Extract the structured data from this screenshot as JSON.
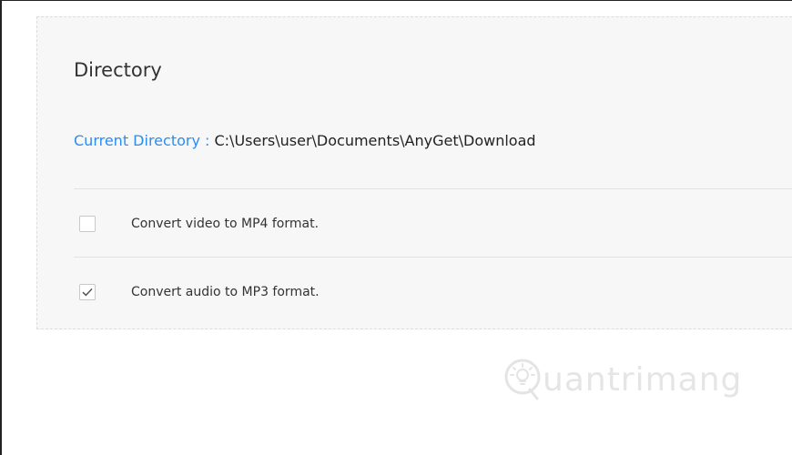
{
  "directory": {
    "title": "Directory",
    "current_label": "Current Directory",
    "separator": " : ",
    "current_path": "C:\\Users\\user\\Documents\\AnyGet\\Download"
  },
  "options": [
    {
      "label": "Convert video to MP4 format.",
      "checked": false
    },
    {
      "label": "Convert audio to MP3 format.",
      "checked": true
    }
  ],
  "watermark": {
    "text": "uantrimang",
    "icon": "lightbulb-q-icon"
  },
  "colors": {
    "accent": "#2d8cf0",
    "panel_bg": "#f7f7f7",
    "text": "#333333"
  }
}
